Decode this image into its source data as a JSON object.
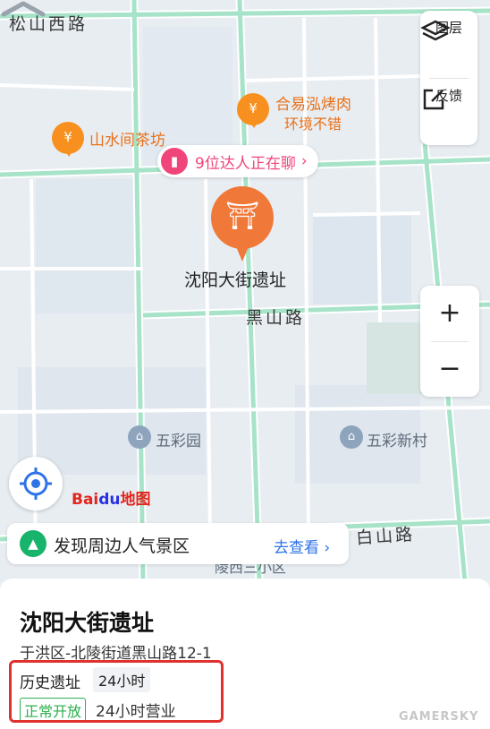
{
  "map": {
    "roads": {
      "songshan_west": "松山西路",
      "heishan": "黑山路",
      "baishan": "白山路"
    },
    "pois": {
      "hotpot_name": "合易泓烤肉",
      "hotpot_tag": "环境不错",
      "teahouse": "山水间茶坊",
      "wucaiyuan": "五彩园",
      "wucai_xincun": "五彩新村",
      "partial_bottom": "陵西三小区"
    },
    "chat_bubble": "9位达人正在聊",
    "main_poi_name": "沈阳大街遗址",
    "logo": {
      "bai": "Bai",
      "du": "du",
      "ditu": "地图"
    }
  },
  "controls": {
    "layers_label": "图层",
    "feedback_label": "反馈",
    "zoom_in": "+",
    "zoom_out": "−"
  },
  "discover": {
    "text": "发现周边人气景区",
    "go_label": "去查看"
  },
  "panel": {
    "title": "沈阳大街遗址",
    "address": "于洪区-北陵街道黑山路12-1",
    "category": "历史遗址",
    "hours_tag": "24小时",
    "status": "正常开放",
    "hours_text": "24小时营业"
  },
  "watermark": "GAMERSKY",
  "colors": {
    "accent_orange": "#f0793a",
    "pink": "#f0457a",
    "green_status": "#2bb04f",
    "link_blue": "#2f73e8",
    "highlight_red": "#e0312f",
    "road_green": "#a6e3c8"
  }
}
